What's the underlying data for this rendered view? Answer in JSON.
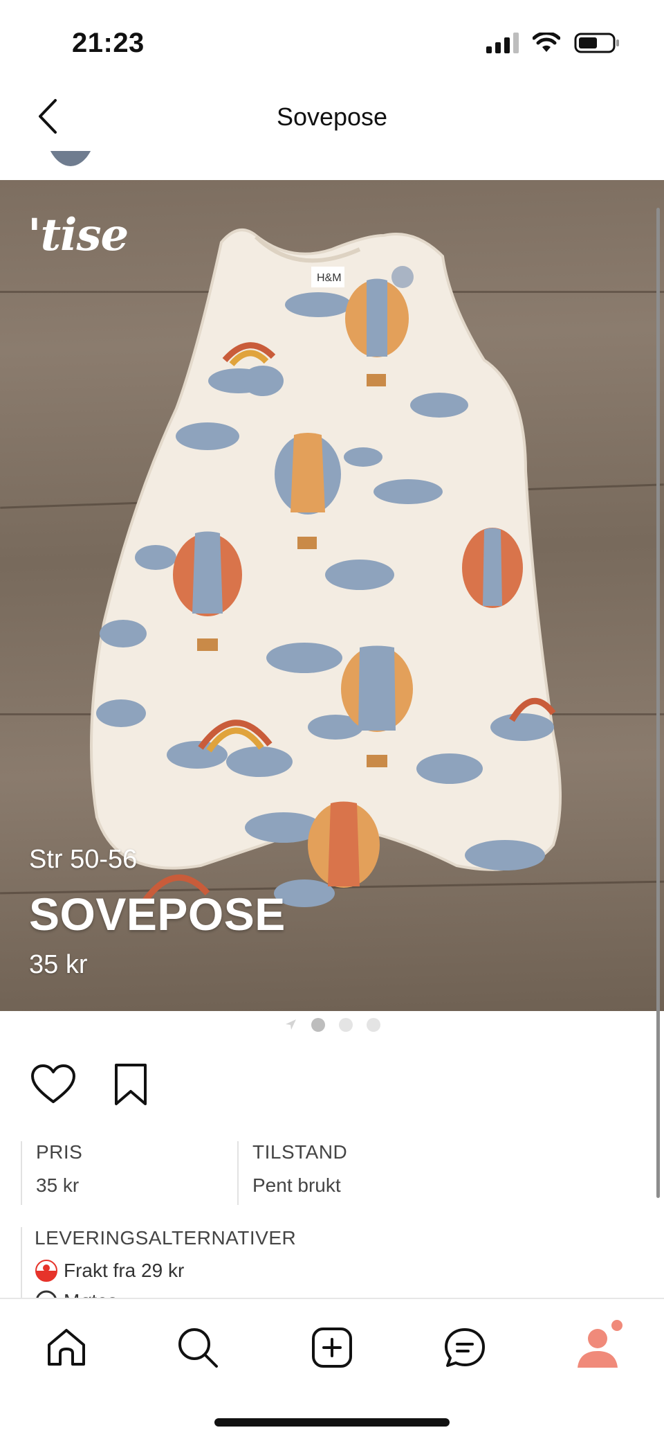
{
  "status_bar": {
    "time": "21:23"
  },
  "header": {
    "title": "Sovepose"
  },
  "product_image": {
    "watermark": "'tise",
    "size": "Str 50-56",
    "title": "SOVEPOSE",
    "price": "35 kr",
    "garment_brand_label": "H&M"
  },
  "carousel": {
    "total_dots": 3,
    "active_index": 0
  },
  "info": {
    "price_label": "PRIS",
    "price_value": "35 kr",
    "condition_label": "TILSTAND",
    "condition_value": "Pent brukt"
  },
  "delivery": {
    "label": "LEVERINGSALTERNATIVER",
    "options": [
      "Frakt fra 29 kr",
      "Møtes"
    ]
  },
  "nav": {
    "items": [
      "home-icon",
      "search-icon",
      "add-listing-icon",
      "messages-icon",
      "profile-icon"
    ],
    "accent_color": "#f08a7a"
  }
}
